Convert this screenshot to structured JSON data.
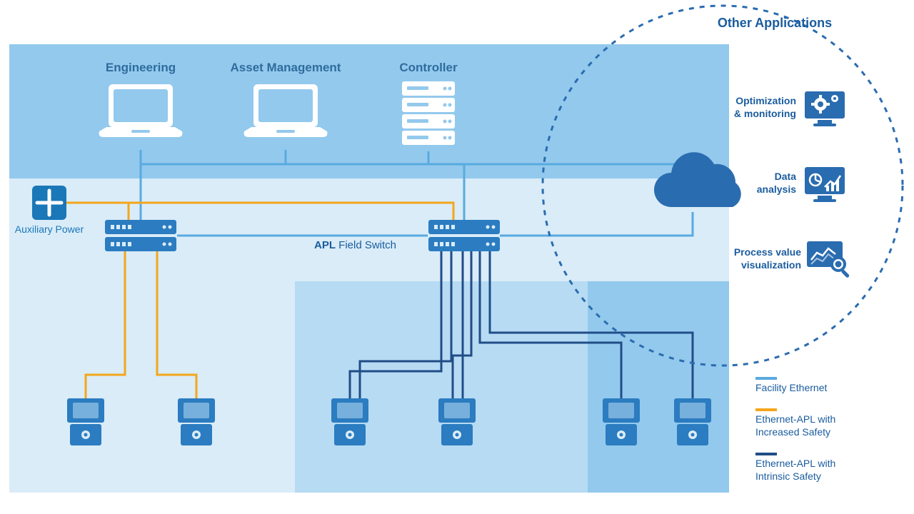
{
  "top_nodes": {
    "engineering": "Engineering",
    "asset_management": "Asset Management",
    "controller": "Controller"
  },
  "auxiliary_power": "Auxiliary Power",
  "apl_field_switch": {
    "bold": "APL",
    "rest": " Field Switch"
  },
  "other_apps": {
    "title": "Other Applications",
    "optimization1": "Optimization",
    "optimization2": "& monitoring",
    "data_analysis1": "Data",
    "data_analysis2": "analysis",
    "process1": "Process value",
    "process2": "visualization"
  },
  "legend": {
    "facility": "Facility Ethernet",
    "increased1": "Ethernet-APL with",
    "increased2": "Increased Safety",
    "intrinsic1": "Ethernet-APL with",
    "intrinsic2": "Intrinsic Safety"
  },
  "colors": {
    "bg_lightest": "#d9ecf8",
    "bg_mid": "#b7dbf3",
    "bg_top": "#93c9ed",
    "blue_primary": "#1a77b8",
    "blue_dark": "#214d87",
    "orange": "#f4a61b",
    "blue_icon": "#2b7cc0",
    "white": "#ffffff"
  }
}
